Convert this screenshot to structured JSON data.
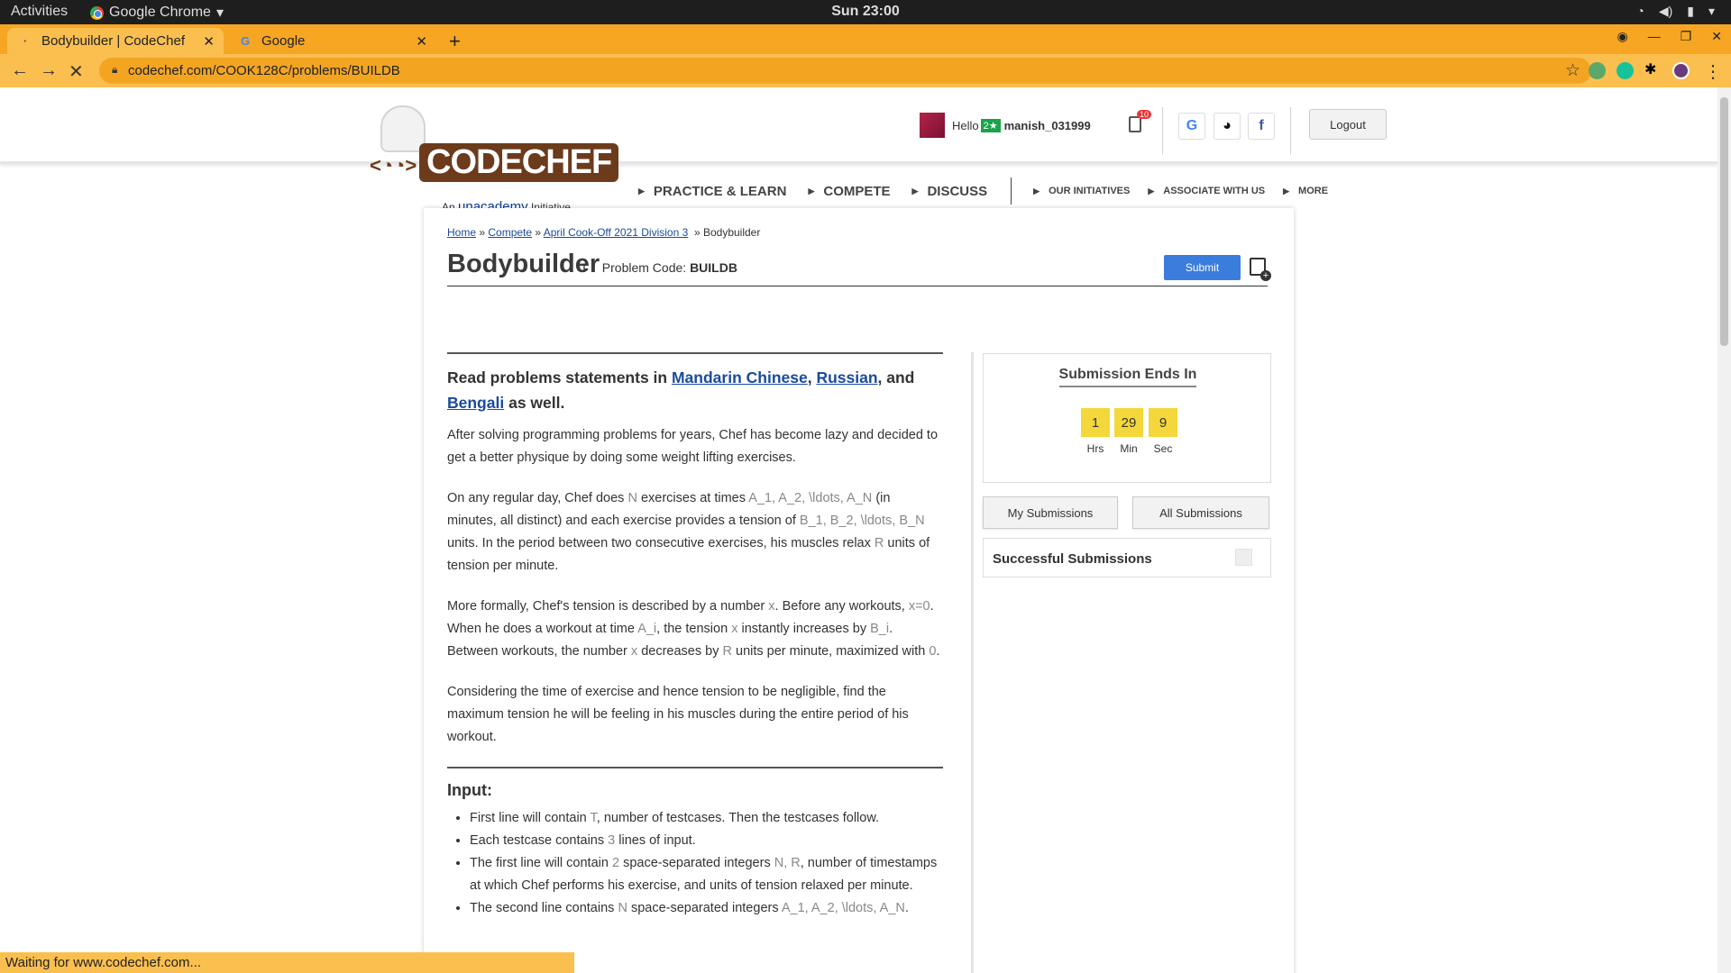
{
  "os_bar": {
    "activities": "Activities",
    "app": "Google Chrome",
    "clock": "Sun 23:00"
  },
  "tabs": [
    {
      "title": "Bodybuilder | CodeChef"
    },
    {
      "title": "Google"
    }
  ],
  "address": {
    "url": "codechef.com/COOK128C/problems/BUILDB"
  },
  "header": {
    "tagline_prefix": "An",
    "tagline_brand": "unacademy",
    "tagline_suffix": "Initiative",
    "logo_text": "CODECHEF",
    "hello": "Hello",
    "stars": "2★",
    "username": "manish_031999",
    "notif_count": "10",
    "logout": "Logout"
  },
  "nav": {
    "items": [
      "PRACTICE & LEARN",
      "COMPETE",
      "DISCUSS"
    ],
    "small_items": [
      "OUR INITIATIVES",
      "ASSOCIATE WITH US",
      "MORE"
    ]
  },
  "breadcrumb": {
    "home": "Home",
    "compete": "Compete",
    "contest": "April Cook-Off 2021 Division 3",
    "current": "Bodybuilder"
  },
  "problem": {
    "title": "Bodybuilder",
    "sep": "I",
    "code_label": "Problem Code:",
    "code": "BUILDB",
    "submit": "Submit"
  },
  "statement": {
    "langs_prefix": "Read problems statements in",
    "lang1": "Mandarin Chinese",
    "lang2": "Russian",
    "langs_and": ", and",
    "lang3": "Bengali",
    "langs_suffix": "as well.",
    "p1": "After solving programming problems for years, Chef has become lazy and decided to get a better physique by doing some weight lifting exercises.",
    "p2a": "On any regular day, Chef does",
    "p2_N": "N",
    "p2b": "exercises at times",
    "p2_A": "A_1, A_2, \\ldots, A_N",
    "p2c": "(in minutes, all distinct) and each exercise provides a tension of",
    "p2_B": "B_1, B_2, \\ldots, B_N",
    "p2d": "units. In the period between two consecutive exercises, his muscles relax",
    "p2_R": "R",
    "p2e": "units of tension per minute.",
    "p3a": "More formally, Chef's tension is described by a number",
    "p3_x": "x",
    "p3b": ". Before any workouts,",
    "p3_x0": "x=0",
    "p3c": ". When he does a workout at time",
    "p3_Ai": "A_i",
    "p3d": ", the tension",
    "p3_x2": "x",
    "p3e": "instantly increases by",
    "p3_Bi": "B_i",
    "p3f": ". Between workouts, the number",
    "p3_x3": "x",
    "p3g": "decreases by",
    "p3_R": "R",
    "p3h": "units per minute, maximized with",
    "p3_0": "0",
    "p3i": ".",
    "p4": "Considering the time of exercise and hence tension to be negligible, find the maximum tension he will be feeling in his muscles during the entire period of his workout.",
    "input_heading": "Input:",
    "li1a": "First line will contain",
    "li1_T": "T",
    "li1b": ", number of testcases. Then the testcases follow.",
    "li2a": "Each testcase contains",
    "li2_3": "3",
    "li2b": "lines of input.",
    "li3a": "The first line will contain",
    "li3_2": "2",
    "li3b": "space-separated integers",
    "li3_NR": "N, R",
    "li3c": ", number of timestamps at which Chef performs his exercise, and units of tension relaxed per minute.",
    "li4a": "The second line contains",
    "li4_N": "N",
    "li4b": "space-separated integers",
    "li4_A": "A_1, A_2, \\ldots, A_N",
    "li4c": "."
  },
  "sidebar": {
    "timer_title": "Submission Ends In",
    "hrs": "1",
    "min": "29",
    "sec": "9",
    "hrs_label": "Hrs",
    "min_label": "Min",
    "sec_label": "Sec",
    "my_submissions": "My Submissions",
    "all_submissions": "All Submissions",
    "successful": "Successful Submissions"
  },
  "status": "Waiting for www.codechef.com..."
}
